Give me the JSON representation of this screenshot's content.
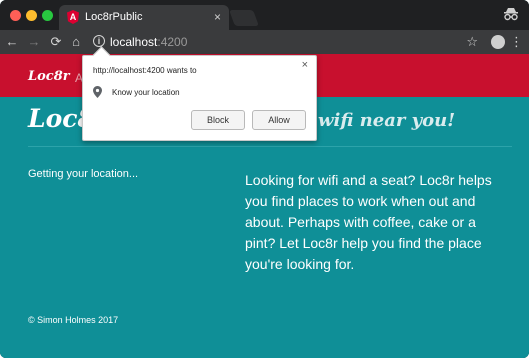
{
  "browser": {
    "tab": {
      "title": "Loc8rPublic",
      "close": "×",
      "favicon_letter": "A"
    },
    "toolbar": {
      "back": "←",
      "forward": "→",
      "reload": "⟳",
      "home": "⌂",
      "url_host": "localhost",
      "url_port": ":4200",
      "star": "☆",
      "menu": "⋮"
    }
  },
  "app": {
    "brand": "Loc8r",
    "nav_link": "A",
    "headline_left": "Loc8r",
    "headline_right": "wifi near you!",
    "status": "Getting your location...",
    "blurb": "Looking for wifi and a seat? Loc8r helps you find places to work when out and about. Perhaps with coffee, cake or a pint? Let Loc8r help you find the place you're looking for.",
    "footer": "© Simon Holmes 2017"
  },
  "permission_popup": {
    "title": "http://localhost:4200 wants to",
    "permission": "Know your location",
    "block": "Block",
    "allow": "Allow",
    "close": "×"
  },
  "colors": {
    "navbar": "#c8102e",
    "page_bg": "#0f8f97",
    "titlebar": "#1f2022",
    "toolbar": "#3a3b3d"
  }
}
